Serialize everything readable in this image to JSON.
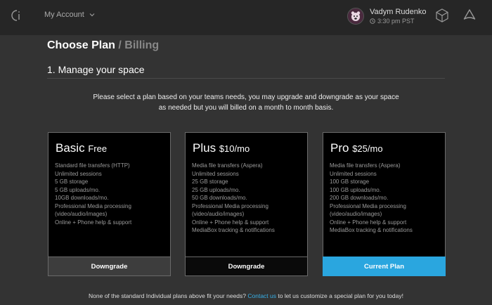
{
  "topbar": {
    "account_label": "My Account",
    "user": {
      "name": "Vadym Rudenko",
      "time": "3:30 pm PST"
    }
  },
  "header": {
    "title": "Choose Plan",
    "separator": "/",
    "breadcrumb": "Billing"
  },
  "section": {
    "title": "1. Manage your space",
    "intro": "Please select a plan based on your teams needs, you may upgrade and downgrade as your space as needed but you will billed on a month to month basis."
  },
  "plans": [
    {
      "name": "Basic",
      "price": "Free",
      "features": [
        "Standard file transfers (HTTP)",
        "Unlimited sessions",
        "5 GB storage",
        "5 GB uploads/mo.",
        "10GB downloads/mo.",
        "Professional Media processing",
        "(video/audio/images)",
        "Online + Phone help & support"
      ],
      "button": "Downgrade"
    },
    {
      "name": "Plus",
      "price": "$10/mo",
      "features": [
        "Media file transfers (Aspera)",
        "Unlimited sessions",
        "25 GB storage",
        "25 GB uploads/mo.",
        "50 GB downloads/mo.",
        "Professional Media processing",
        "(video/audio/images)",
        "Online + Phone help & support",
        "MediaBox tracking & notifications"
      ],
      "button": "Downgrade"
    },
    {
      "name": "Pro",
      "price": "$25/mo",
      "features": [
        "Media file transfers (Aspera)",
        "Unlimited sessions",
        "100 GB storage",
        "100 GB uploads/mo.",
        "200 GB downloads/mo.",
        "Professional Media processing",
        "(video/audio/images)",
        "Online + Phone help & support",
        "MediaBox tracking & notifications"
      ],
      "button": "Current Plan"
    }
  ],
  "footer": {
    "text_before": "None of the standard Individual plans above fit your needs? ",
    "link": "Contact us",
    "text_after": " to let us customize a special plan for you today!"
  },
  "colors": {
    "accent": "#2aa6df",
    "background": "#333333",
    "topbar": "#262626"
  }
}
